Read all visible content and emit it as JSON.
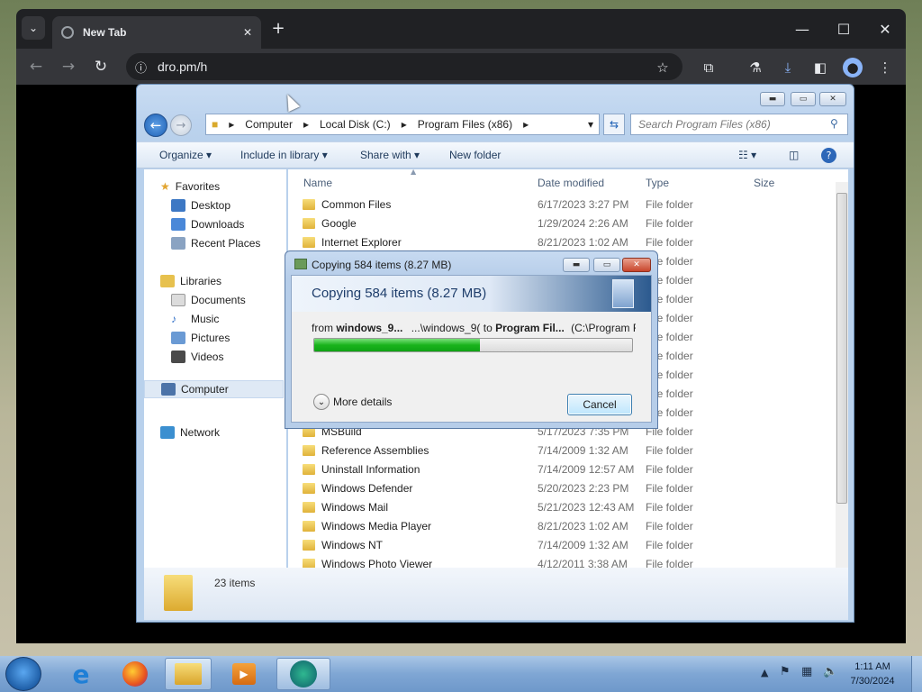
{
  "browser": {
    "tab_title": "New Tab",
    "url": "dro.pm/h",
    "icons": [
      "tab-search-icon",
      "globe-icon",
      "close-icon",
      "new-tab-icon",
      "minimize-icon",
      "maximize-icon",
      "close-window-icon",
      "back-icon",
      "forward-icon",
      "reload-icon",
      "site-info-icon",
      "bookmark-star-icon",
      "extensions-icon",
      "labs-icon",
      "download-icon",
      "side-panel-icon",
      "profile-icon",
      "menu-icon"
    ]
  },
  "explorer": {
    "breadcrumb": [
      "Computer",
      "Local Disk (C:)",
      "Program Files (x86)"
    ],
    "search_placeholder": "Search Program Files (x86)",
    "commands": [
      "Organize",
      "Include in library",
      "Share with",
      "New folder"
    ],
    "nav": {
      "favorites_label": "Favorites",
      "favorites": [
        "Desktop",
        "Downloads",
        "Recent Places"
      ],
      "libraries_label": "Libraries",
      "libraries": [
        "Documents",
        "Music",
        "Pictures",
        "Videos"
      ],
      "computer_label": "Computer",
      "network_label": "Network"
    },
    "columns": [
      "Name",
      "Date modified",
      "Type",
      "Size"
    ],
    "files": [
      {
        "name": "Common Files",
        "date": "6/17/2023 3:27 PM",
        "type": "File folder"
      },
      {
        "name": "Google",
        "date": "1/29/2024 2:26 AM",
        "type": "File folder"
      },
      {
        "name": "Internet Explorer",
        "date": "8/21/2023 1:02 AM",
        "type": "File folder"
      },
      {
        "name": "",
        "date": "",
        "type": "File folder"
      },
      {
        "name": "",
        "date": "",
        "type": "File folder"
      },
      {
        "name": "",
        "date": "",
        "type": "File folder"
      },
      {
        "name": "",
        "date": "",
        "type": "File folder"
      },
      {
        "name": "",
        "date": "",
        "type": "File folder"
      },
      {
        "name": "",
        "date": "",
        "type": "File folder"
      },
      {
        "name": "",
        "date": "",
        "type": "File folder"
      },
      {
        "name": "",
        "date": "",
        "type": "File folder"
      },
      {
        "name": "",
        "date": "",
        "type": "File folder"
      },
      {
        "name": "MSBuild",
        "date": "5/17/2023 7:35 PM",
        "type": "File folder"
      },
      {
        "name": "Reference Assemblies",
        "date": "7/14/2009 1:32 AM",
        "type": "File folder"
      },
      {
        "name": "Uninstall Information",
        "date": "7/14/2009 12:57 AM",
        "type": "File folder"
      },
      {
        "name": "Windows Defender",
        "date": "5/20/2023 2:23 PM",
        "type": "File folder"
      },
      {
        "name": "Windows Mail",
        "date": "5/21/2023 12:43 AM",
        "type": "File folder"
      },
      {
        "name": "Windows Media Player",
        "date": "8/21/2023 1:02 AM",
        "type": "File folder"
      },
      {
        "name": "Windows NT",
        "date": "7/14/2009 1:32 AM",
        "type": "File folder"
      },
      {
        "name": "Windows Photo Viewer",
        "date": "4/12/2011 3:38 AM",
        "type": "File folder"
      }
    ],
    "item_count": "23 items"
  },
  "dialog": {
    "title": "Copying 584 items (8.27 MB)",
    "heading": "Copying 584 items (8.27 MB)",
    "from_label": "from",
    "from_value": "windows_9...",
    "mid": "...\\windows_9(",
    "to_label": "to",
    "to_value": "Program Fil...",
    "to_path": "(C:\\Program F",
    "progress": 0.52,
    "more_details": "More details",
    "cancel": "Cancel"
  },
  "taskbar": {
    "time": "1:11 AM",
    "date": "7/30/2024",
    "apps": [
      "internet-explorer-icon",
      "firefox-icon",
      "explorer-icon",
      "media-icon",
      "remote-app-icon"
    ]
  }
}
